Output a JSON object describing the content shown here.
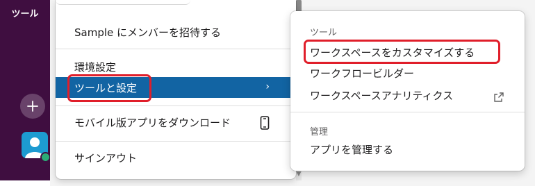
{
  "sidebar": {
    "tool_label": "ツール"
  },
  "menu": {
    "invite": "Sample にメンバーを招待する",
    "preferences": "環境設定",
    "tools_and_settings": "ツールと設定",
    "tools_chevron": "›",
    "mobile_app": "モバイル版アプリをダウンロード",
    "sign_out": "サインアウト"
  },
  "submenu": {
    "tools_heading": "ツール",
    "customize_workspace": "ワークスペースをカスタマイズする",
    "workflow_builder": "ワークフロービルダー",
    "workspace_analytics": "ワークスペースアナリティクス",
    "manage_heading": "管理",
    "manage_apps": "アプリを管理する"
  },
  "colors": {
    "sidebar": "#3f0e40",
    "highlight": "#1264a3",
    "annotation": "#e01e2a",
    "presence": "#2bac76",
    "avatar": "#1d9bd1"
  }
}
